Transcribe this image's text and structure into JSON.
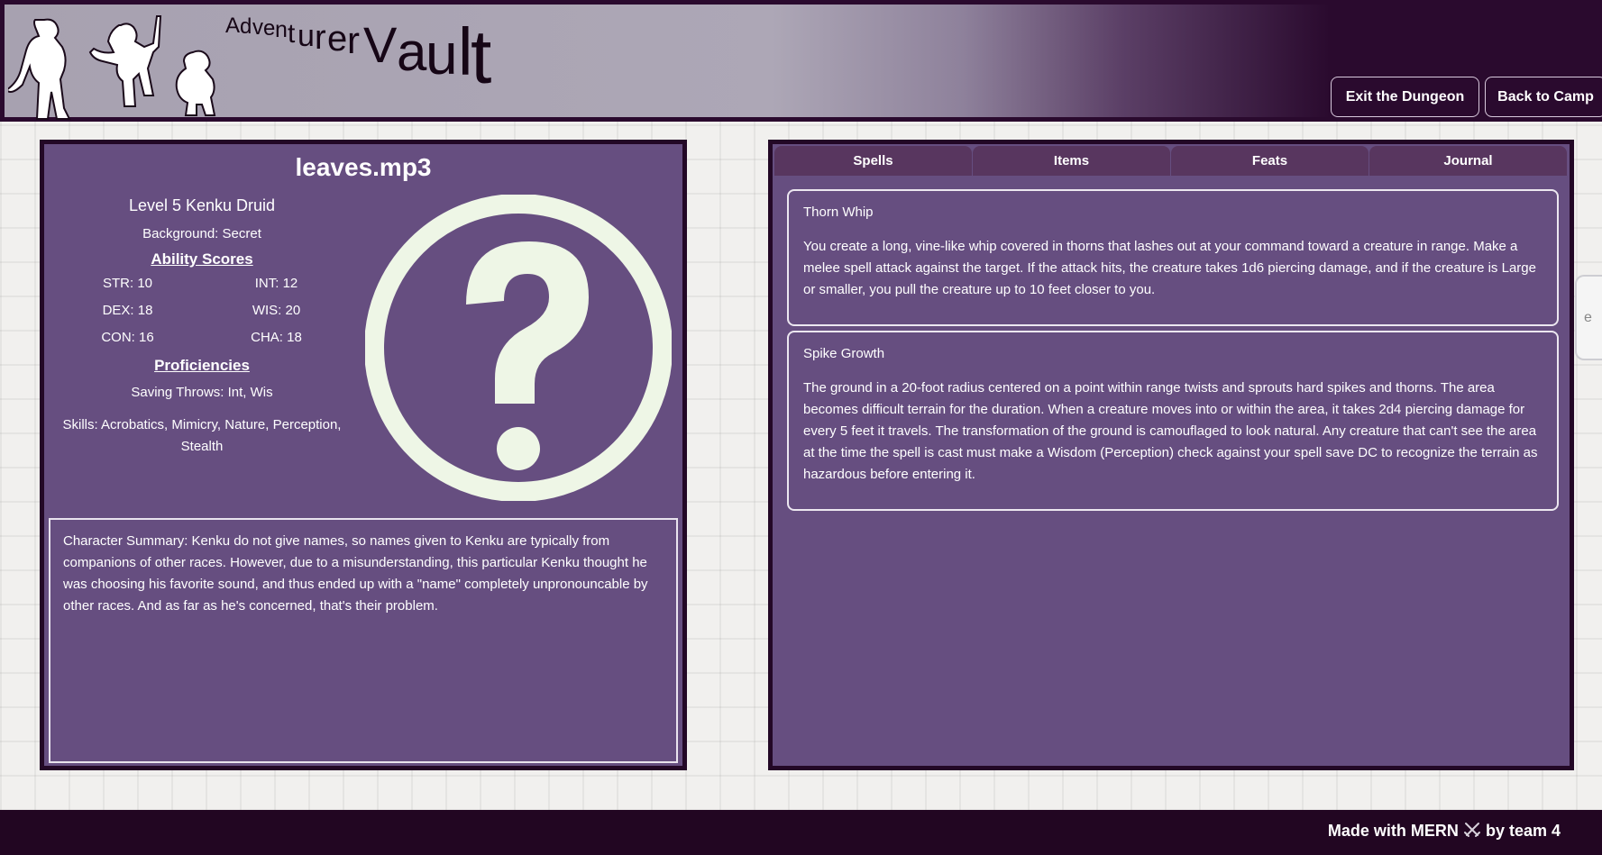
{
  "header": {
    "brand_letters": [
      "A",
      "d",
      "v",
      "e",
      "n",
      "t",
      "u",
      "r",
      "e",
      "r",
      "V",
      "a",
      "u",
      "l",
      "t"
    ],
    "buttons": {
      "exit": "Exit the Dungeon",
      "camp": "Back to Camp"
    }
  },
  "character": {
    "name": "leaves.mp3",
    "level_line": "Level 5 Kenku Druid",
    "background": "Background: Secret",
    "ability_heading": "Ability Scores",
    "abilities": {
      "str": "STR: 10",
      "int": "INT: 12",
      "dex": "DEX: 18",
      "wis": "WIS: 20",
      "con": "CON: 16",
      "cha": "CHA: 18"
    },
    "proficiencies_heading": "Proficiencies",
    "saving_throws": "Saving Throws: Int, Wis",
    "skills": "Skills: Acrobatics, Mimicry, Nature, Perception, Stealth",
    "portrait_icon": "question-mark-circle-icon",
    "summary": "Character Summary: Kenku do not give names, so names given to Kenku are typically from companions of other races. However, due to a misunderstanding, this particular Kenku thought he was choosing his favorite sound, and thus ended up with a \"name\" completely unpronouncable by other races. And as far as he's concerned, that's their problem."
  },
  "tabs": [
    "Spells",
    "Items",
    "Feats",
    "Journal"
  ],
  "spells": [
    {
      "name": "Thorn Whip",
      "description": "You create a long, vine-like whip covered in thorns that lashes out at your command toward a creature in range. Make a melee spell attack against the target. If the attack hits, the creature takes 1d6 piercing damage, and if the creature is Large or smaller, you pull the creature up to 10 feet closer to you."
    },
    {
      "name": "Spike Growth",
      "description": "The ground in a 20-foot radius centered on a point within range twists and sprouts hard spikes and thorns. The area becomes difficult terrain for the duration. When a creature moves into or within the area, it takes 2d4 piercing damage for every 5 feet it travels. The transformation of the ground is camouflaged to look natural. Any creature that can't see the area at the time the spell is cast must make a Wisdom (Perception) check against your spell save DC to recognize the terrain as hazardous before entering it."
    }
  ],
  "side_tab_glyph": "e",
  "footer": {
    "made_with": "Made with MERN",
    "icon": "crossed-swords-icon",
    "by_team": "by team 4"
  },
  "colors": {
    "header_dark": "#2a0a2e",
    "panel": "#664e80",
    "tab": "#58365f",
    "footer": "#220622",
    "portrait": "#eef6e6"
  }
}
